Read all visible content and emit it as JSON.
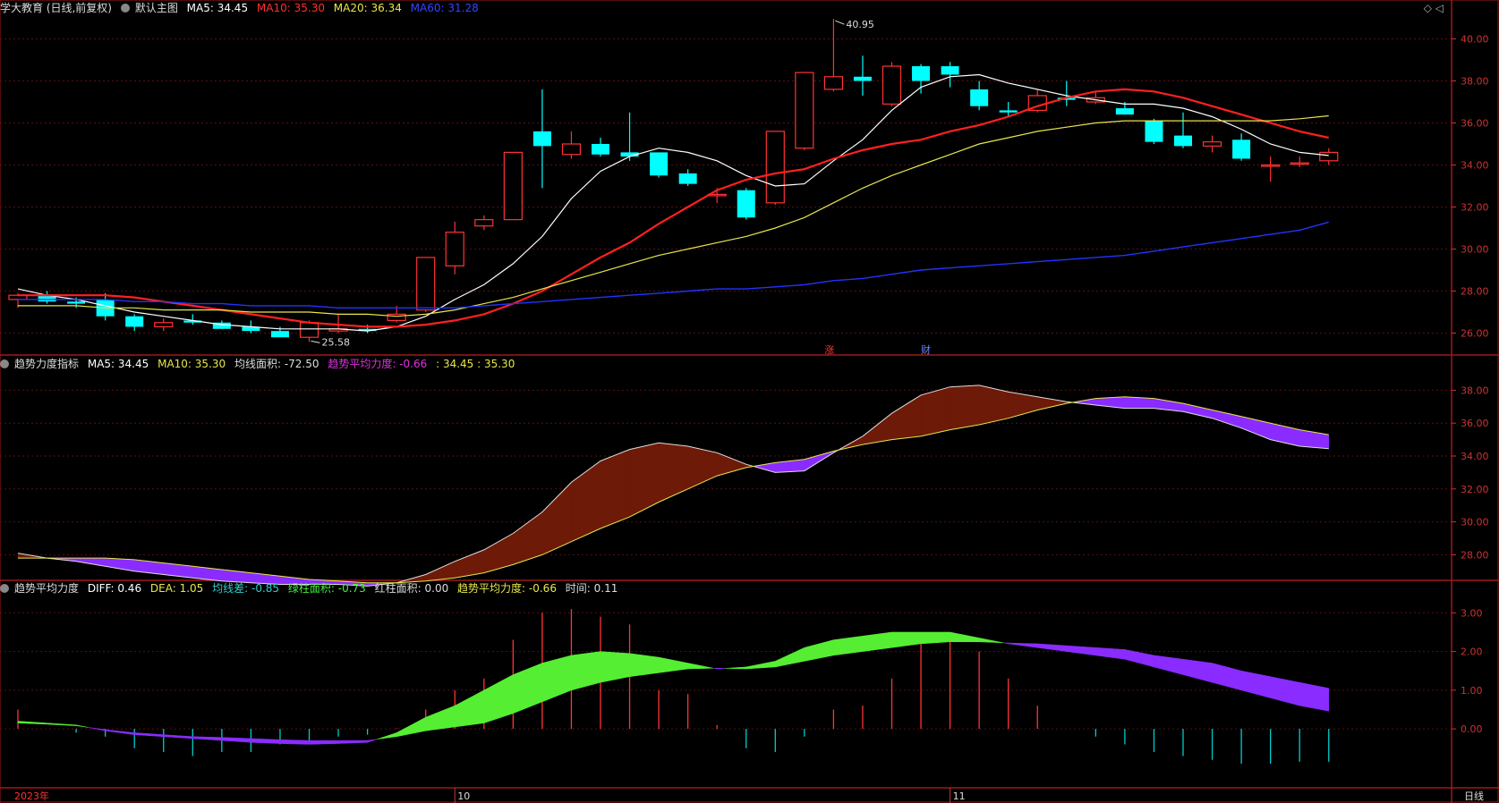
{
  "header_main": {
    "title": "学大教育 (日线,前复权)",
    "subtitle": "默认主图",
    "ma5": "MA5: 34.45",
    "ma10": "MA10: 35.30",
    "ma20": "MA20: 36.34",
    "ma60": "MA60: 31.28"
  },
  "header_ind1": {
    "name": "趋势力度指标",
    "ma5": "MA5: 34.45",
    "ma10": "MA10: 35.30",
    "area": "均线面积: -72.50",
    "avg": "趋势平均力度: -0.66",
    "pair": ": 34.45 : 35.30"
  },
  "header_ind2": {
    "name": "趋势平均力度",
    "diff": "DIFF: 0.46",
    "dea": "DEA: 1.05",
    "madiff": "均线差: -0.85",
    "green": "绿柱面积: -0.73",
    "red": "红柱面积: 0.00",
    "avg": "趋势平均力度: -0.66",
    "time": "时间: 0.11"
  },
  "footer": {
    "year": "2023年",
    "oct": "10",
    "nov": "11",
    "period": "日线"
  },
  "markers": {
    "zhang": "涨",
    "cai": "财",
    "high": "40.95",
    "low": "25.58"
  },
  "colors": {
    "up": "#ff3333",
    "down": "#00ffff",
    "ma5": "#ffffff",
    "ma10": "#ff2020",
    "ma20": "#e6e64c",
    "ma60": "#2233ff"
  },
  "chart_data": [
    {
      "type": "candlestick",
      "title": "学大教育 (日线,前复权)",
      "ylim": [
        25,
        41
      ],
      "yticks": [
        26,
        28,
        30,
        32,
        34,
        36,
        38,
        40
      ],
      "ytick_labels": [
        "26.00",
        "28.00",
        "30.00",
        "32.00",
        "34.00",
        "36.00",
        "38.00",
        "40.00"
      ],
      "candles": [
        {
          "o": 27.6,
          "h": 27.9,
          "l": 27.2,
          "c": 27.8
        },
        {
          "o": 27.8,
          "h": 28.0,
          "l": 27.4,
          "c": 27.5
        },
        {
          "o": 27.5,
          "h": 27.7,
          "l": 27.2,
          "c": 27.4
        },
        {
          "o": 27.6,
          "h": 27.9,
          "l": 26.6,
          "c": 26.8
        },
        {
          "o": 26.8,
          "h": 26.9,
          "l": 26.1,
          "c": 26.3
        },
        {
          "o": 26.3,
          "h": 26.7,
          "l": 26.1,
          "c": 26.5
        },
        {
          "o": 26.6,
          "h": 26.9,
          "l": 26.4,
          "c": 26.5
        },
        {
          "o": 26.5,
          "h": 26.6,
          "l": 26.2,
          "c": 26.2
        },
        {
          "o": 26.3,
          "h": 26.6,
          "l": 26.0,
          "c": 26.1
        },
        {
          "o": 26.1,
          "h": 26.3,
          "l": 25.8,
          "c": 25.8
        },
        {
          "o": 25.8,
          "h": 26.6,
          "l": 25.58,
          "c": 26.5
        },
        {
          "o": 26.1,
          "h": 26.9,
          "l": 26.0,
          "c": 26.2
        },
        {
          "o": 26.2,
          "h": 26.4,
          "l": 26.0,
          "c": 26.1
        },
        {
          "o": 26.6,
          "h": 27.3,
          "l": 26.5,
          "c": 26.9
        },
        {
          "o": 27.1,
          "h": 29.6,
          "l": 27.0,
          "c": 29.6
        },
        {
          "o": 29.2,
          "h": 31.3,
          "l": 28.8,
          "c": 30.8
        },
        {
          "o": 31.1,
          "h": 31.6,
          "l": 30.9,
          "c": 31.4
        },
        {
          "o": 31.4,
          "h": 34.6,
          "l": 31.4,
          "c": 34.6
        },
        {
          "o": 35.6,
          "h": 37.6,
          "l": 32.9,
          "c": 34.9
        },
        {
          "o": 34.5,
          "h": 35.6,
          "l": 34.3,
          "c": 35.0
        },
        {
          "o": 35.0,
          "h": 35.3,
          "l": 34.4,
          "c": 34.5
        },
        {
          "o": 34.6,
          "h": 36.5,
          "l": 34.2,
          "c": 34.4
        },
        {
          "o": 34.6,
          "h": 34.6,
          "l": 33.4,
          "c": 33.5
        },
        {
          "o": 33.6,
          "h": 33.8,
          "l": 33.0,
          "c": 33.1
        },
        {
          "o": 32.6,
          "h": 32.9,
          "l": 32.2,
          "c": 32.6
        },
        {
          "o": 32.8,
          "h": 32.9,
          "l": 31.4,
          "c": 31.5
        },
        {
          "o": 32.2,
          "h": 35.6,
          "l": 32.1,
          "c": 35.6
        },
        {
          "o": 34.8,
          "h": 38.4,
          "l": 34.7,
          "c": 38.4
        },
        {
          "o": 37.6,
          "h": 40.95,
          "l": 37.5,
          "c": 38.2
        },
        {
          "o": 38.2,
          "h": 39.2,
          "l": 37.3,
          "c": 38.0
        },
        {
          "o": 36.9,
          "h": 38.9,
          "l": 36.8,
          "c": 38.7
        },
        {
          "o": 38.7,
          "h": 38.8,
          "l": 37.4,
          "c": 38.0
        },
        {
          "o": 38.7,
          "h": 38.9,
          "l": 37.7,
          "c": 38.3
        },
        {
          "o": 37.6,
          "h": 38.0,
          "l": 36.6,
          "c": 36.8
        },
        {
          "o": 36.6,
          "h": 37.0,
          "l": 36.3,
          "c": 36.5
        },
        {
          "o": 36.6,
          "h": 37.6,
          "l": 36.5,
          "c": 37.3
        },
        {
          "o": 37.2,
          "h": 38.0,
          "l": 36.8,
          "c": 37.1
        },
        {
          "o": 37.0,
          "h": 37.5,
          "l": 36.9,
          "c": 37.2
        },
        {
          "o": 36.7,
          "h": 37.0,
          "l": 36.4,
          "c": 36.4
        },
        {
          "o": 36.1,
          "h": 36.2,
          "l": 35.0,
          "c": 35.1
        },
        {
          "o": 35.4,
          "h": 36.5,
          "l": 34.8,
          "c": 34.9
        },
        {
          "o": 34.9,
          "h": 35.4,
          "l": 34.6,
          "c": 35.1
        },
        {
          "o": 35.2,
          "h": 35.5,
          "l": 34.2,
          "c": 34.3
        },
        {
          "o": 34.0,
          "h": 34.4,
          "l": 33.2,
          "c": 34.0
        },
        {
          "o": 34.1,
          "h": 34.4,
          "l": 33.9,
          "c": 34.1
        },
        {
          "o": 34.2,
          "h": 34.8,
          "l": 34.0,
          "c": 34.6
        }
      ],
      "series": [
        {
          "name": "MA5",
          "values": [
            28.1,
            27.8,
            27.6,
            27.3,
            27.0,
            26.8,
            26.6,
            26.4,
            26.3,
            26.2,
            26.2,
            26.2,
            26.1,
            26.3,
            26.8,
            27.6,
            28.3,
            29.3,
            30.6,
            32.4,
            33.7,
            34.4,
            34.8,
            34.6,
            34.2,
            33.5,
            33.0,
            33.1,
            34.2,
            35.2,
            36.6,
            37.7,
            38.2,
            38.3,
            37.9,
            37.6,
            37.3,
            37.1,
            36.9,
            36.9,
            36.7,
            36.3,
            35.7,
            35.0,
            34.6,
            34.45
          ]
        },
        {
          "name": "MA10",
          "values": [
            27.8,
            27.8,
            27.8,
            27.8,
            27.7,
            27.5,
            27.3,
            27.1,
            26.9,
            26.7,
            26.5,
            26.4,
            26.3,
            26.3,
            26.4,
            26.6,
            26.9,
            27.4,
            28.0,
            28.8,
            29.6,
            30.3,
            31.2,
            32.0,
            32.8,
            33.3,
            33.6,
            33.8,
            34.3,
            34.7,
            35.0,
            35.2,
            35.6,
            35.9,
            36.3,
            36.8,
            37.2,
            37.5,
            37.6,
            37.5,
            37.2,
            36.8,
            36.4,
            36.0,
            35.6,
            35.3
          ]
        },
        {
          "name": "MA20",
          "values": [
            27.3,
            27.3,
            27.3,
            27.2,
            27.2,
            27.1,
            27.1,
            27.1,
            27.0,
            27.0,
            27.0,
            26.9,
            26.9,
            26.8,
            26.9,
            27.1,
            27.4,
            27.7,
            28.1,
            28.5,
            28.9,
            29.3,
            29.7,
            30.0,
            30.3,
            30.6,
            31.0,
            31.5,
            32.2,
            32.9,
            33.5,
            34.0,
            34.5,
            35.0,
            35.3,
            35.6,
            35.8,
            36.0,
            36.1,
            36.1,
            36.1,
            36.1,
            36.1,
            36.1,
            36.2,
            36.34
          ]
        },
        {
          "name": "MA60",
          "values": [
            27.6,
            27.6,
            27.6,
            27.6,
            27.5,
            27.5,
            27.4,
            27.4,
            27.3,
            27.3,
            27.3,
            27.2,
            27.2,
            27.2,
            27.2,
            27.2,
            27.3,
            27.4,
            27.5,
            27.6,
            27.7,
            27.8,
            27.9,
            28.0,
            28.1,
            28.1,
            28.2,
            28.3,
            28.5,
            28.6,
            28.8,
            29.0,
            29.1,
            29.2,
            29.3,
            29.4,
            29.5,
            29.6,
            29.7,
            29.9,
            30.1,
            30.3,
            30.5,
            30.7,
            30.9,
            31.28
          ]
        }
      ]
    },
    {
      "type": "area",
      "title": "趋势力度指标",
      "ylim": [
        26.5,
        39
      ],
      "yticks": [
        28,
        30,
        32,
        34,
        36,
        38
      ],
      "ytick_labels": [
        "28.00",
        "30.00",
        "32.00",
        "34.00",
        "36.00",
        "38.00"
      ],
      "series": [
        {
          "name": "MA5",
          "values": [
            28.1,
            27.8,
            27.6,
            27.3,
            27.0,
            26.8,
            26.6,
            26.4,
            26.3,
            26.2,
            26.2,
            26.2,
            26.1,
            26.3,
            26.8,
            27.6,
            28.3,
            29.3,
            30.6,
            32.4,
            33.7,
            34.4,
            34.8,
            34.6,
            34.2,
            33.5,
            33.0,
            33.1,
            34.2,
            35.2,
            36.6,
            37.7,
            38.2,
            38.3,
            37.9,
            37.6,
            37.3,
            37.1,
            36.9,
            36.9,
            36.7,
            36.3,
            35.7,
            35.0,
            34.6,
            34.45
          ]
        },
        {
          "name": "MA10",
          "values": [
            27.8,
            27.8,
            27.8,
            27.8,
            27.7,
            27.5,
            27.3,
            27.1,
            26.9,
            26.7,
            26.5,
            26.4,
            26.3,
            26.3,
            26.4,
            26.6,
            26.9,
            27.4,
            28.0,
            28.8,
            29.6,
            30.3,
            31.2,
            32.0,
            32.8,
            33.3,
            33.6,
            33.8,
            34.3,
            34.7,
            35.0,
            35.2,
            35.6,
            35.9,
            36.3,
            36.8,
            37.2,
            37.5,
            37.6,
            37.5,
            37.2,
            36.8,
            36.4,
            36.0,
            35.6,
            35.3
          ]
        }
      ]
    },
    {
      "type": "bar+area",
      "title": "趋势平均力度",
      "ylim": [
        -1.5,
        3.4
      ],
      "yticks": [
        0,
        1,
        2,
        3
      ],
      "ytick_labels": [
        "0.00",
        "1.00",
        "2.00",
        "3.00"
      ],
      "bars": [
        0.5,
        0,
        -0.1,
        -0.2,
        -0.5,
        -0.6,
        -0.7,
        -0.6,
        -0.6,
        -0.4,
        -0.3,
        -0.2,
        -0.15,
        0.02,
        0.5,
        1.0,
        1.3,
        2.3,
        3.0,
        3.1,
        2.9,
        2.7,
        1.0,
        0.9,
        0.1,
        -0.5,
        -0.6,
        -0.2,
        0.5,
        0.6,
        1.3,
        2.3,
        2.5,
        2.0,
        1.3,
        0.6,
        0.0,
        -0.2,
        -0.4,
        -0.6,
        -0.7,
        -0.8,
        -0.9,
        -0.9,
        -0.85,
        -0.85
      ],
      "series": [
        {
          "name": "DIFF",
          "values": [
            0.2,
            0.15,
            0.1,
            -0.05,
            -0.15,
            -0.2,
            -0.25,
            -0.3,
            -0.35,
            -0.38,
            -0.4,
            -0.38,
            -0.35,
            -0.1,
            0.3,
            0.6,
            1.0,
            1.4,
            1.7,
            1.9,
            2.0,
            1.95,
            1.85,
            1.7,
            1.55,
            1.6,
            1.75,
            2.1,
            2.3,
            2.4,
            2.5,
            2.5,
            2.5,
            2.35,
            2.2,
            2.1,
            2.0,
            1.9,
            1.8,
            1.6,
            1.4,
            1.2,
            1.0,
            0.8,
            0.6,
            0.46
          ]
        },
        {
          "name": "DEA",
          "values": [
            0.15,
            0.12,
            0.08,
            -0.02,
            -0.1,
            -0.15,
            -0.2,
            -0.22,
            -0.25,
            -0.28,
            -0.3,
            -0.3,
            -0.3,
            -0.2,
            -0.05,
            0.05,
            0.15,
            0.4,
            0.7,
            1.0,
            1.2,
            1.35,
            1.45,
            1.55,
            1.57,
            1.55,
            1.6,
            1.75,
            1.9,
            2.0,
            2.1,
            2.2,
            2.25,
            2.25,
            2.22,
            2.2,
            2.15,
            2.1,
            2.05,
            1.9,
            1.8,
            1.7,
            1.5,
            1.35,
            1.2,
            1.05
          ]
        }
      ]
    }
  ]
}
